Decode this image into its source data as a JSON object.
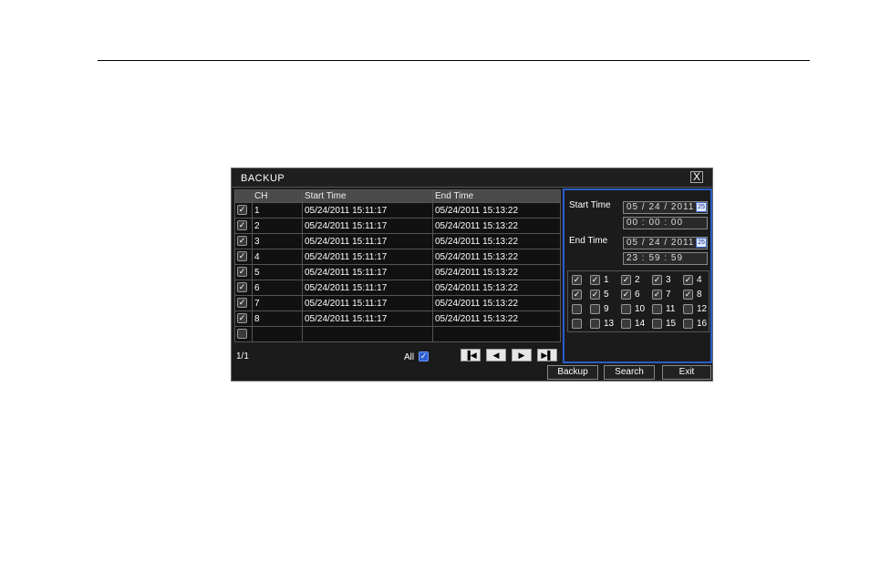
{
  "dialog": {
    "title": "BACKUP",
    "close_label": "X"
  },
  "table": {
    "headers": [
      "CH",
      "Start Time",
      "End Time"
    ],
    "rows": [
      {
        "ch": "1",
        "start": "05/24/2011 15:11:17",
        "end": "05/24/2011 15:13:22",
        "checked": true
      },
      {
        "ch": "2",
        "start": "05/24/2011 15:11:17",
        "end": "05/24/2011 15:13:22",
        "checked": true
      },
      {
        "ch": "3",
        "start": "05/24/2011 15:11:17",
        "end": "05/24/2011 15:13:22",
        "checked": true
      },
      {
        "ch": "4",
        "start": "05/24/2011 15:11:17",
        "end": "05/24/2011 15:13:22",
        "checked": true
      },
      {
        "ch": "5",
        "start": "05/24/2011 15:11:17",
        "end": "05/24/2011 15:13:22",
        "checked": true
      },
      {
        "ch": "6",
        "start": "05/24/2011 15:11:17",
        "end": "05/24/2011 15:13:22",
        "checked": true
      },
      {
        "ch": "7",
        "start": "05/24/2011 15:11:17",
        "end": "05/24/2011 15:13:22",
        "checked": true
      },
      {
        "ch": "8",
        "start": "05/24/2011 15:11:17",
        "end": "05/24/2011 15:13:22",
        "checked": true
      },
      {
        "ch": "",
        "start": "",
        "end": "",
        "checked": false
      }
    ]
  },
  "footer": {
    "page": "1/1",
    "all_label": "All",
    "all_checked": true
  },
  "nav": {
    "first": "▐◀",
    "prev": "◀",
    "next": "▶",
    "last": "▶▌"
  },
  "search_panel": {
    "start_label": "Start Time",
    "start_date": "05 / 24 / 2011",
    "start_time": "00 : 00 : 00",
    "end_label": "End Time",
    "end_date": "05 / 24 / 2011",
    "end_time": "23 : 59 : 59",
    "calendar_icon": "calendar-icon",
    "channels": [
      {
        "label": "",
        "checked": true,
        "is_all": true
      },
      {
        "label": "1",
        "checked": true
      },
      {
        "label": "2",
        "checked": true
      },
      {
        "label": "3",
        "checked": true
      },
      {
        "label": "4",
        "checked": true
      },
      {
        "label": "",
        "checked": true,
        "is_all": true
      },
      {
        "label": "5",
        "checked": true
      },
      {
        "label": "6",
        "checked": true
      },
      {
        "label": "7",
        "checked": true
      },
      {
        "label": "8",
        "checked": true
      },
      {
        "label": "",
        "checked": false,
        "is_all": true
      },
      {
        "label": "9",
        "checked": false
      },
      {
        "label": "10",
        "checked": false
      },
      {
        "label": "11",
        "checked": false
      },
      {
        "label": "12",
        "checked": false
      },
      {
        "label": "",
        "checked": false,
        "is_all": true
      },
      {
        "label": "13",
        "checked": false
      },
      {
        "label": "14",
        "checked": false
      },
      {
        "label": "15",
        "checked": false
      },
      {
        "label": "16",
        "checked": false
      }
    ]
  },
  "buttons": {
    "backup": "Backup",
    "search": "Search",
    "exit": "Exit"
  },
  "colors": {
    "panel_border": "#2a5ec8",
    "dialog_bg": "#1b1b1b",
    "header_bg": "#4a4a4a"
  }
}
